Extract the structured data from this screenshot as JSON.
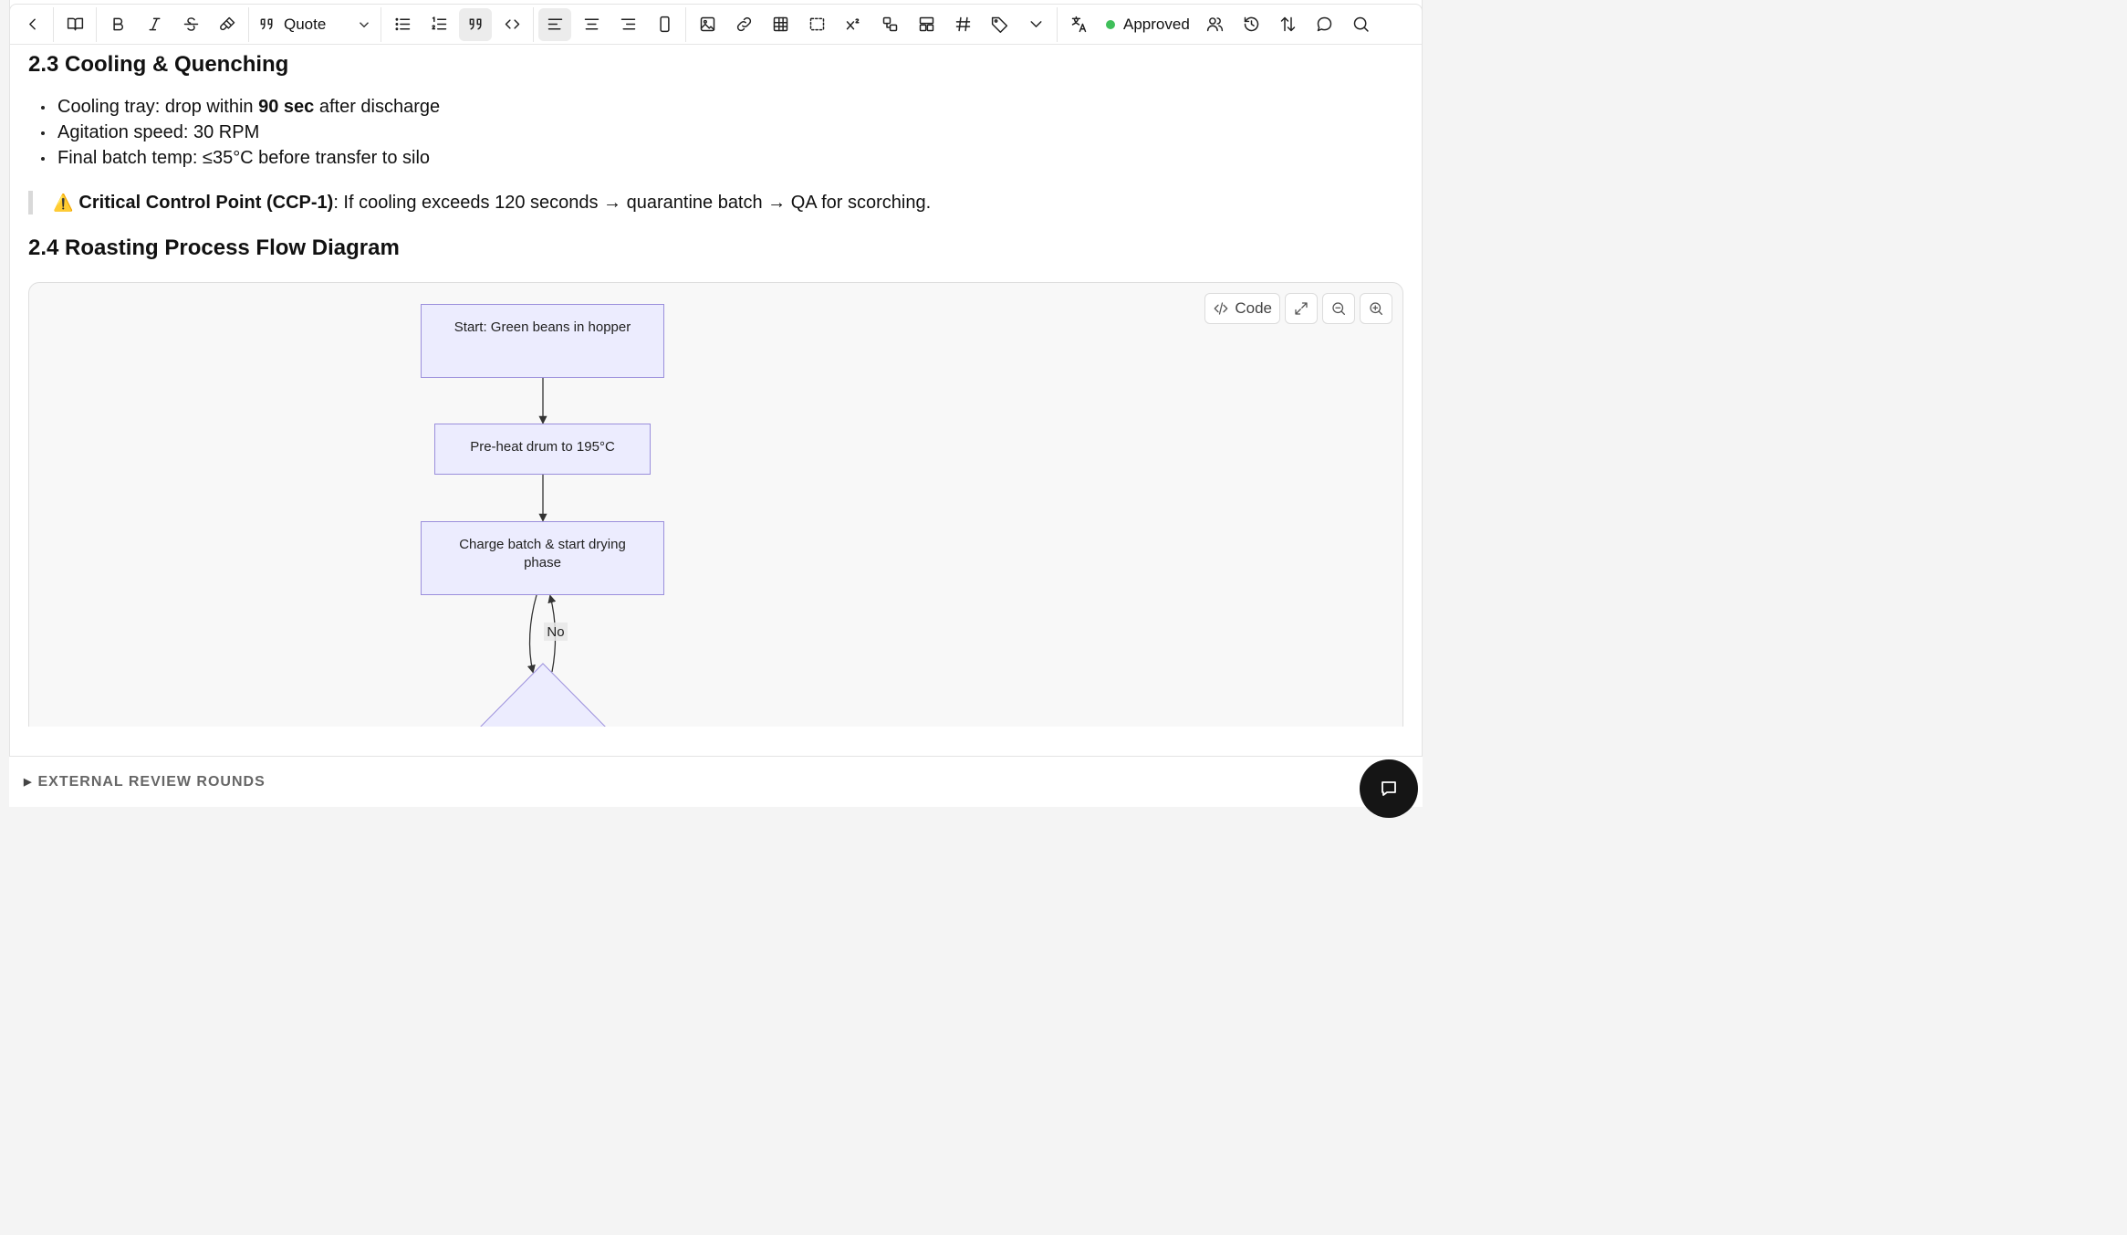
{
  "toolbar": {
    "block_type": "Quote",
    "status": "Approved",
    "status_color": "#3fbf5a",
    "icons": [
      "chevron-left-icon",
      "book-icon",
      "bold-icon",
      "italic-icon",
      "strikethrough-icon",
      "paint-brush-icon",
      "quote-icon",
      "chevron-down-icon",
      "bullet-list-icon",
      "numbered-list-icon",
      "blockquote-icon",
      "code-icon",
      "align-left-icon",
      "align-center-icon",
      "align-right-icon",
      "mobile-icon",
      "image-icon",
      "link-icon",
      "table-icon",
      "selection-icon",
      "superscript-icon",
      "shapes-icon",
      "layout-icon",
      "hash-icon",
      "tag-icon",
      "chevron-down-icon",
      "translate-icon",
      "users-icon",
      "history-icon",
      "sort-icon",
      "comment-icon",
      "search-icon"
    ]
  },
  "section_cooling": {
    "heading": "2.3 Cooling & Quenching",
    "bullets": [
      {
        "pre": "Cooling tray: drop within ",
        "bold": "90 sec",
        "post": " after discharge"
      },
      {
        "pre": "Agitation speed: 30 RPM",
        "bold": "",
        "post": ""
      },
      {
        "pre": "Final batch temp: ≤35°C before transfer to silo",
        "bold": "",
        "post": ""
      }
    ],
    "callout": {
      "icon": "⚠️",
      "bold": "Critical Control Point (CCP-1)",
      "text": ": If cooling exceeds 120 seconds → quarantine batch → QA for scorching."
    }
  },
  "section_flow": {
    "heading": "2.4 Roasting Process Flow Diagram",
    "diagram_buttons": {
      "code": "Code"
    },
    "nodes": [
      "Start: Green beans in hopper",
      "Pre-heat drum to 195°C",
      "Charge batch & start drying phase"
    ],
    "edge_label_no": "No",
    "node_fill": "#ececfe",
    "node_stroke": "#9b8fdc"
  },
  "footer": {
    "label": "EXTERNAL REVIEW ROUNDS"
  }
}
